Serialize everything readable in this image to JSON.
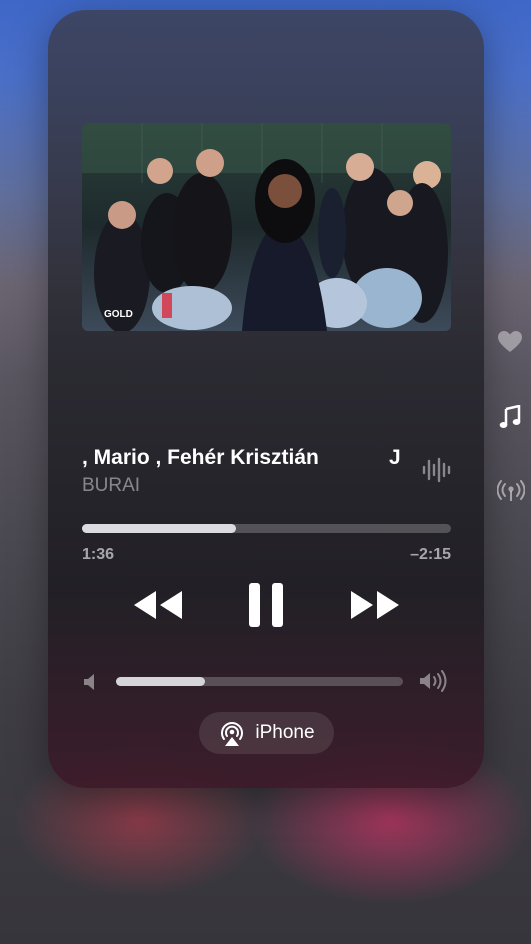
{
  "now_playing": {
    "title": ", Mario , Fehér Krisztián",
    "title_suffix": "J",
    "artist": "BURAI",
    "artwork_logo": "GOLD",
    "wave_icon": "waveform-icon"
  },
  "playback": {
    "elapsed": "1:36",
    "remaining": "–2:15",
    "progress_fraction": 0.416
  },
  "controls": {
    "previous_icon": "rewind-icon",
    "play_pause_icon": "pause-icon",
    "next_icon": "fast-forward-icon"
  },
  "volume": {
    "level_fraction": 0.31,
    "low_icon": "speaker-low-icon",
    "high_icon": "speaker-high-icon"
  },
  "output": {
    "device_label": "iPhone",
    "icon": "airplay-audio-icon"
  },
  "side_controls": [
    {
      "icon": "heart-icon"
    },
    {
      "icon": "music-note-icon"
    },
    {
      "icon": "broadcast-icon"
    }
  ]
}
